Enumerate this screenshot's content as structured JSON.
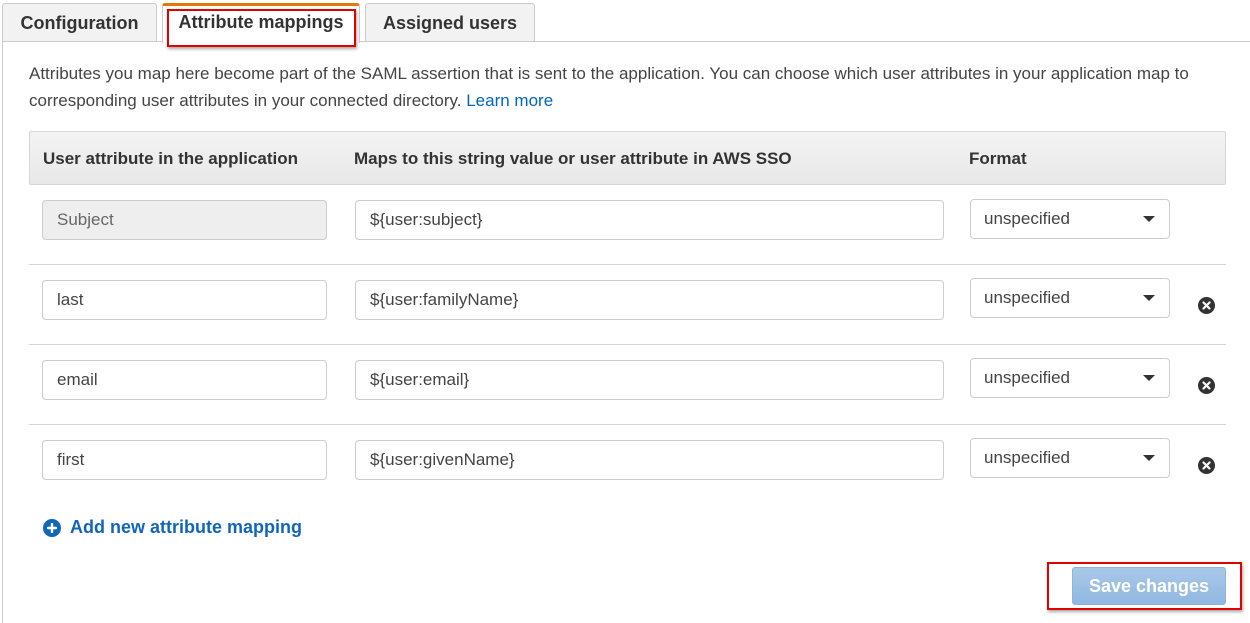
{
  "tabs": [
    {
      "label": "Configuration",
      "active": false
    },
    {
      "label": "Attribute mappings",
      "active": true
    },
    {
      "label": "Assigned users",
      "active": false
    }
  ],
  "description": {
    "text": "Attributes you map here become part of the SAML assertion that is sent to the application. You can choose which user attributes in your application map to corresponding user attributes in your connected directory.",
    "link_label": "Learn more"
  },
  "table": {
    "headers": [
      "User attribute in the application",
      "Maps to this string value or user attribute in AWS SSO",
      "Format"
    ],
    "rows": [
      {
        "app_attribute": "Subject",
        "mapping": "${user:subject}",
        "format": "unspecified",
        "editable": false,
        "removable": false
      },
      {
        "app_attribute": "last",
        "mapping": "${user:familyName}",
        "format": "unspecified",
        "editable": true,
        "removable": true
      },
      {
        "app_attribute": "email",
        "mapping": "${user:email}",
        "format": "unspecified",
        "editable": true,
        "removable": true
      },
      {
        "app_attribute": "first",
        "mapping": "${user:givenName}",
        "format": "unspecified",
        "editable": true,
        "removable": true
      }
    ]
  },
  "add_mapping_label": "Add new attribute mapping",
  "save_label": "Save changes",
  "colors": {
    "active_tab_accent": "#e07b00",
    "link": "#0066c0",
    "primary_button_disabled": "#9dc0e4",
    "annotation_highlight": "#e00000"
  }
}
